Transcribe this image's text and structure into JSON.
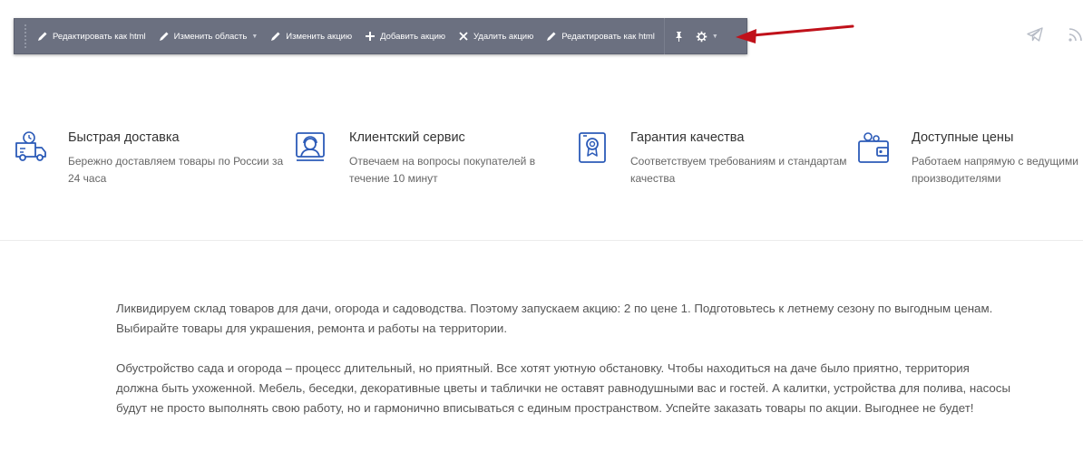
{
  "toolbar": {
    "items": [
      {
        "label": "Редактировать как html",
        "icon": "pencil-icon"
      },
      {
        "label": "Изменить область",
        "icon": "pencil-icon",
        "dropdown": true
      },
      {
        "label": "Изменить акцию",
        "icon": "pencil-icon"
      },
      {
        "label": "Добавить акцию",
        "icon": "plus-icon"
      },
      {
        "label": "Удалить акцию",
        "icon": "close-icon"
      },
      {
        "label": "Редактировать как html",
        "icon": "pencil-icon"
      }
    ],
    "pin_icon": "pin-icon",
    "settings_icon": "gear-icon"
  },
  "top_icons": [
    "telegram-icon",
    "rss-icon"
  ],
  "features": [
    {
      "title": "Быстрая доставка",
      "desc": "Бережно доставляем товары по России за 24 часа",
      "icon": "delivery-truck-icon"
    },
    {
      "title": "Клиентский сервис",
      "desc": "Отвечаем на вопросы покупателей в течение 10 минут",
      "icon": "customer-service-icon"
    },
    {
      "title": "Гарантия качества",
      "desc": "Соответствуем требованиям и стандартам качества",
      "icon": "certificate-icon"
    },
    {
      "title": "Доступные цены",
      "desc": "Работаем напрямую с ведущими производителями",
      "icon": "wallet-icon"
    }
  ],
  "content": {
    "paragraph_1": "Ликвидируем склад товаров для дачи, огорода и садоводства. Поэтому запускаем акцию: 2 по цене 1. Подготовьтесь к летнему сезону по выгодным ценам. Выбирайте товары для украшения, ремонта и работы на территории.",
    "paragraph_2": "Обустройство сада и огорода – процесс длительный, но приятный. Все хотят уютную обстановку. Чтобы находиться на даче было приятно, территория должна быть ухоженной. Мебель, беседки, декоративные цветы и таблички не оставят равнодушными вас и гостей. А калитки, устройства для полива, насосы будут не просто выполнять свою работу, но и гармонично вписываться с единым пространством. Успейте заказать товары по акции. Выгоднее не будет!"
  },
  "colors": {
    "toolbar_bg": "#6b7080",
    "accent_blue": "#2c5bb8",
    "arrow_red": "#c0111a"
  }
}
